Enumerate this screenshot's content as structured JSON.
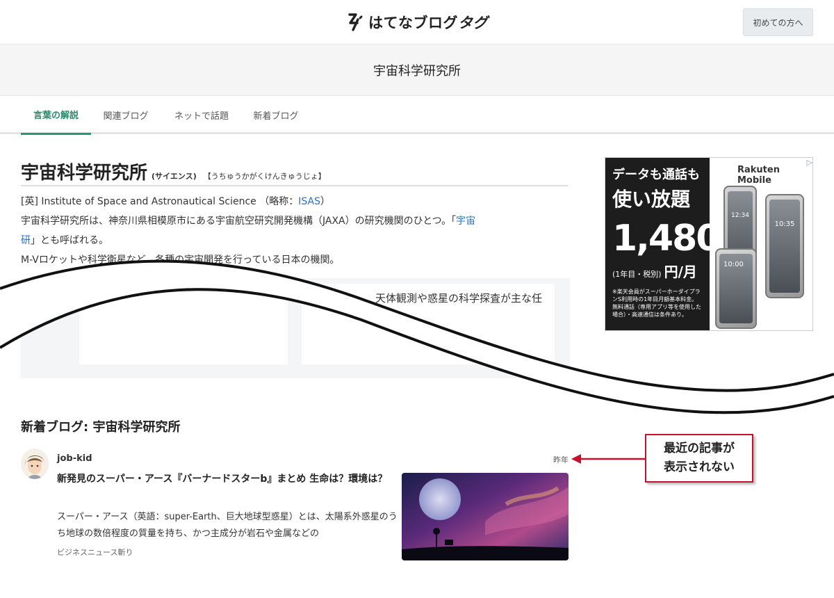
{
  "header": {
    "logo_text": "はてなブログ",
    "logo_text_em": "タグ",
    "first_time_button": "初めての方へ"
  },
  "page_title": "宇宙科学研究所",
  "tabs": [
    {
      "label": "言葉の解説",
      "active": true
    },
    {
      "label": "関連ブログ",
      "active": false
    },
    {
      "label": "ネットで話題",
      "active": false
    },
    {
      "label": "新着ブログ",
      "active": false
    }
  ],
  "keyword": {
    "title": "宇宙科学研究所",
    "kana_note": "(サイエンス)",
    "reading": "【うちゅうかがくけんきゅうじょ】",
    "line1_prefix": "[英] Institute of Space and Astronautical Science （略称：",
    "line1_link": "ISAS",
    "line1_suffix": "）",
    "line2_prefix": "宇宙科学研究所は、神奈川県相模原市にある宇宙航空研究開発機構（JAXA）の研究機関のひとつ。「",
    "line2_link_a": "宇宙",
    "line3_link_b": "研",
    "line3_suffix": "」とも呼ばれる。",
    "line4": "M-Vロケットや科学衛星など、各種の宇宙開発を行っている日本の機関。",
    "card_text": "天体観測や惑星の科学探査が主な任"
  },
  "ad": {
    "headline1": "データも通話も",
    "headline2": "使い放題",
    "price": "1,480",
    "price_note": "(1年目・税別)",
    "price_unit": "円/月",
    "footnote": "※楽天会員がスーパーホーダイプランS利用時の1年目月額基本料金。無料通話（専用アプリ等を使用した場合）・高速通信は条件あり。",
    "brand": "Rakuten Mobile",
    "corner": "▷",
    "phone_time_1": "12:34",
    "phone_time_2": "10:35",
    "phone_time_3": "10:00"
  },
  "new_blogs": {
    "section_title": "新着ブログ: 宇宙科学研究所",
    "entry": {
      "author": "job-kid",
      "date": "昨年",
      "title": "新発見のスーパー・アース『バーナードスターb』まとめ 生命は？環境は？",
      "summary": "スーパー・アース（英語：super-Earth、巨大地球型惑星）とは、太陽系外惑星のうち地球の数倍程度の質量を持ち、かつ主成分が岩石や金属などの",
      "blog_name": "ビジネスニュース斬り"
    }
  },
  "annotation": {
    "callout_line1": "最近の記事が",
    "callout_line2": "表示されない",
    "arrow_color": "#c8102e"
  }
}
